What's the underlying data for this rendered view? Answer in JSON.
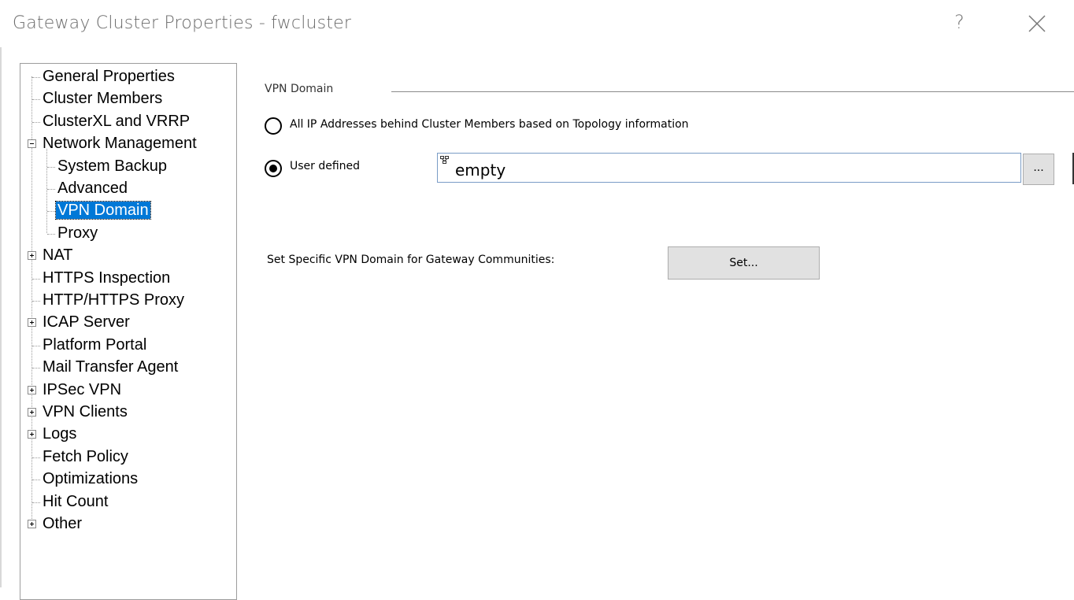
{
  "window": {
    "title": "Gateway Cluster Properties - fwcluster",
    "help_label": "?"
  },
  "tree": {
    "items": [
      {
        "label": "General Properties",
        "level": 0,
        "expander": "none"
      },
      {
        "label": "Cluster Members",
        "level": 0,
        "expander": "none"
      },
      {
        "label": "ClusterXL and VRRP",
        "level": 0,
        "expander": "none"
      },
      {
        "label": "Network Management",
        "level": 0,
        "expander": "expanded"
      },
      {
        "label": "System Backup",
        "level": 1,
        "expander": "none"
      },
      {
        "label": "Advanced",
        "level": 1,
        "expander": "none"
      },
      {
        "label": "VPN Domain",
        "level": 1,
        "expander": "none",
        "selected": true
      },
      {
        "label": "Proxy",
        "level": 1,
        "expander": "none"
      },
      {
        "label": "NAT",
        "level": 0,
        "expander": "collapsed"
      },
      {
        "label": "HTTPS Inspection",
        "level": 0,
        "expander": "none"
      },
      {
        "label": "HTTP/HTTPS Proxy",
        "level": 0,
        "expander": "none"
      },
      {
        "label": "ICAP Server",
        "level": 0,
        "expander": "collapsed"
      },
      {
        "label": "Platform Portal",
        "level": 0,
        "expander": "none"
      },
      {
        "label": "Mail Transfer Agent",
        "level": 0,
        "expander": "none"
      },
      {
        "label": "IPSec VPN",
        "level": 0,
        "expander": "collapsed"
      },
      {
        "label": "VPN Clients",
        "level": 0,
        "expander": "collapsed"
      },
      {
        "label": "Logs",
        "level": 0,
        "expander": "collapsed"
      },
      {
        "label": "Fetch Policy",
        "level": 0,
        "expander": "none"
      },
      {
        "label": "Optimizations",
        "level": 0,
        "expander": "none"
      },
      {
        "label": "Hit Count",
        "level": 0,
        "expander": "none"
      },
      {
        "label": "Other",
        "level": 0,
        "expander": "collapsed"
      }
    ]
  },
  "vpn_domain": {
    "section_title": "VPN Domain",
    "option_all_label": "All IP Addresses behind Cluster Members based on Topology information",
    "option_all_selected": false,
    "option_user_label": "User defined",
    "option_user_selected": true,
    "domain_value": "empty",
    "browse_label": "...",
    "communities_label": "Set Specific VPN Domain for Gateway Communities:",
    "set_button_label": "Set..."
  }
}
